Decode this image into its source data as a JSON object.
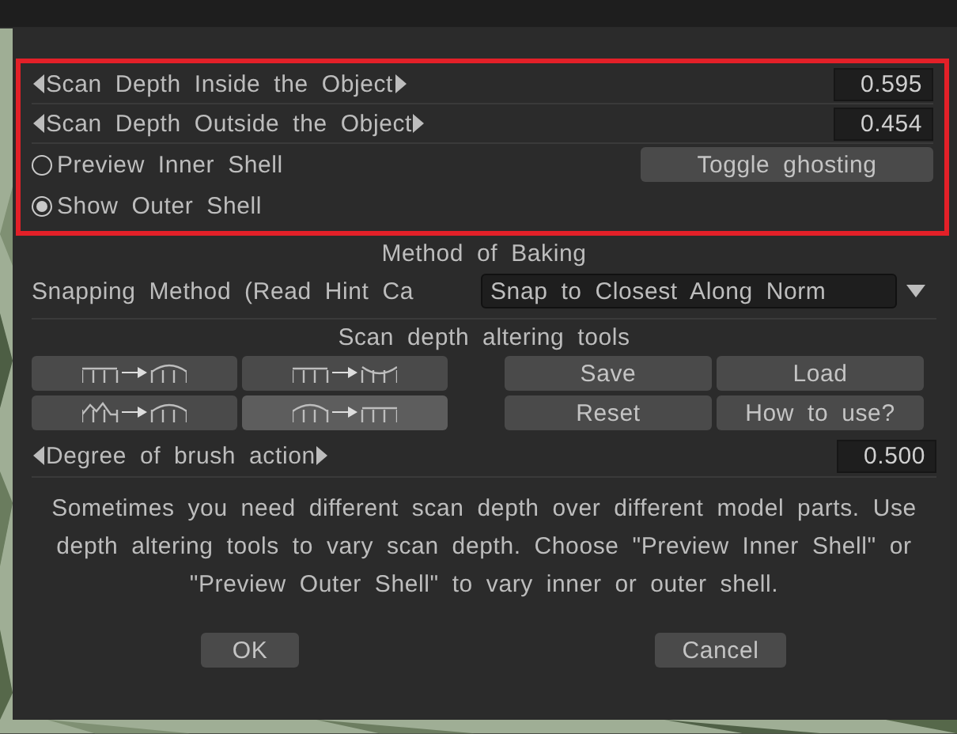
{
  "scan_params": [
    {
      "label": "Scan Depth Inside the Object",
      "value": "0.595"
    },
    {
      "label": "Scan Depth Outside the Object",
      "value": "0.454"
    }
  ],
  "shell_options": [
    {
      "label": "Preview Inner Shell",
      "selected": false
    },
    {
      "label": "Show Outer Shell",
      "selected": true
    }
  ],
  "toggle_button": "Toggle ghosting",
  "section_title": "Method of Baking",
  "snapping": {
    "label": "Snapping Method (Read Hint Ca",
    "value": "Snap to Closest Along Norm"
  },
  "tools_title": "Scan depth altering tools",
  "tools": [
    {
      "kind": "raise",
      "selected": false
    },
    {
      "kind": "lower",
      "selected": false
    },
    {
      "kind": "smooth",
      "selected": false
    },
    {
      "kind": "flatten",
      "selected": true
    }
  ],
  "actions": [
    "Save",
    "Load",
    "Reset",
    "How to use?"
  ],
  "brush": {
    "label": "Degree of brush action",
    "value": "0.500"
  },
  "help_text": "Sometimes you need different scan depth over different model parts. Use depth altering tools to vary scan depth. Choose \"Preview Inner Shell\" or \"Preview Outer Shell\" to vary inner or outer shell.",
  "buttons": [
    "OK",
    "Cancel"
  ]
}
